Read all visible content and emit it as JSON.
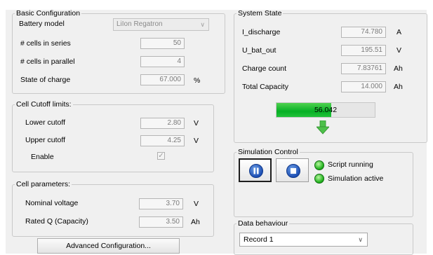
{
  "basic_config": {
    "title": "Basic Configuration",
    "battery_model_label": "Battery model",
    "battery_model_value": "LiIon Regatron",
    "cells_series_label": "# cells in series",
    "cells_series_value": "50",
    "cells_parallel_label": "# cells in parallel",
    "cells_parallel_value": "4",
    "soc_label": "State of charge",
    "soc_value": "67.000",
    "soc_unit": "%"
  },
  "cutoff": {
    "title": "Cell Cutoff limits:",
    "lower_label": "Lower cutoff",
    "lower_value": "2.80",
    "lower_unit": "V",
    "upper_label": "Upper cutoff",
    "upper_value": "4.25",
    "upper_unit": "V",
    "enable_label": "Enable",
    "enable_checked": true
  },
  "cell_params": {
    "title": "Cell parameters:",
    "nominal_label": "Nominal voltage",
    "nominal_value": "3.70",
    "nominal_unit": "V",
    "rated_label": "Rated Q (Capacity)",
    "rated_value": "3.50",
    "rated_unit": "Ah"
  },
  "advanced_button": "Advanced Configuration...",
  "system_state": {
    "title": "System State",
    "i_discharge_label": "I_discharge",
    "i_discharge_value": "74.780",
    "i_discharge_unit": "A",
    "u_bat_label": "U_bat_out",
    "u_bat_value": "195.51",
    "u_bat_unit": "V",
    "charge_count_label": "Charge count",
    "charge_count_value": "7.83761",
    "charge_count_unit": "Ah",
    "total_capacity_label": "Total Capacity",
    "total_capacity_value": "14.000",
    "total_capacity_unit": "Ah",
    "progress_text": "56.042",
    "progress_fraction": 0.56
  },
  "simulation": {
    "title": "Simulation Control",
    "status1": "Script running",
    "status2": "Simulation active"
  },
  "data_behaviour": {
    "title": "Data behaviour",
    "selected": "Record 1"
  },
  "colors": {
    "progress_green": "#06b025",
    "led_green": "#22b21e",
    "icon_blue": "#1d4fb4"
  }
}
